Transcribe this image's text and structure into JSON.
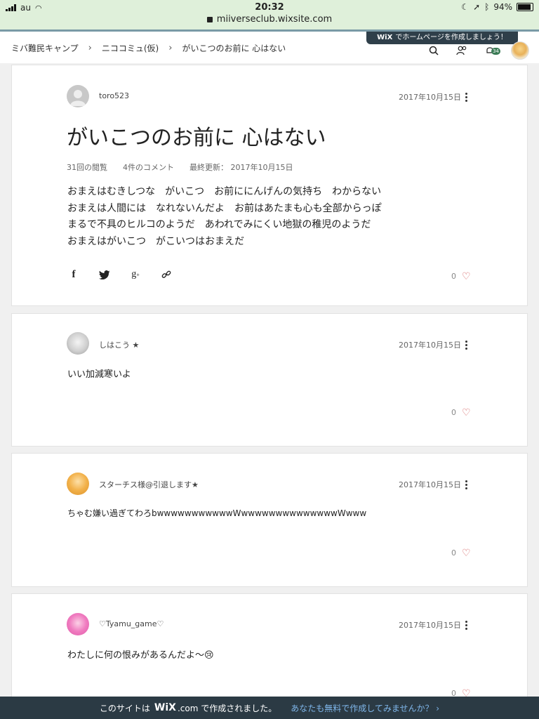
{
  "status_bar": {
    "carrier": "au",
    "time": "20:32",
    "battery": "94%",
    "url": "miiverseclub.wixsite.com"
  },
  "nav": {
    "breadcrumbs": [
      "ミバ難民キャンプ",
      "ニココミュ(仮)",
      "がいこつのお前に 心はない"
    ],
    "wix_banner_brand": "WiX",
    "wix_banner_text": "でホームページを作成しましょう！",
    "notification_count": "34"
  },
  "post": {
    "author": "toro523",
    "date": "2017年10月15日",
    "title": "がいこつのお前に 心はない",
    "views": "31回の閲覧",
    "comments": "4件のコメント",
    "updated": "最終更新： 2017年10月15日",
    "body_lines": [
      "おまえはむきしつな　がいこつ　お前ににんげんの気持ち　わからない",
      "おまえは人間には　なれないんだよ　お前はあたまも心も全部からっぽ",
      "まるで不具のヒルコのようだ　あわれでみにくい地獄の稚児のようだ",
      "おまえはがいこつ　がこいつはおまえだ"
    ],
    "likes": "0"
  },
  "comments": [
    {
      "author": "しはこう ★",
      "date": "2017年10月15日",
      "text": "いい加減寒いよ",
      "likes": "0"
    },
    {
      "author": "スターチス様@引退します★",
      "date": "2017年10月15日",
      "text": "ちゃむ嫌い過ぎてわろbwwwwwwwwwwwWwwwwwwwwwwwwwwWwww",
      "likes": "0"
    },
    {
      "author": "♡Tyamu_game♡",
      "date": "2017年10月15日",
      "text": "わたしに何の恨みがあるんだよ〜😢",
      "likes": "0"
    }
  ],
  "footer": {
    "prefix": "このサイトは",
    "brand": "WiX",
    "suffix": ".com で作成されました。",
    "cta": "あなたも無料で作成してみませんか？ ›"
  },
  "icons": {
    "share": [
      "facebook-icon",
      "twitter-icon",
      "google-plus-icon",
      "link-icon"
    ],
    "nav": [
      "search-icon",
      "members-icon",
      "notifications-icon",
      "user-avatar"
    ]
  },
  "colors": {
    "status_bg": "#dff0da",
    "banner_bg": "#2f3f4a",
    "footer_bg": "#2b3a44",
    "heart": "#d35c5c",
    "link": "#7fb6ea"
  }
}
